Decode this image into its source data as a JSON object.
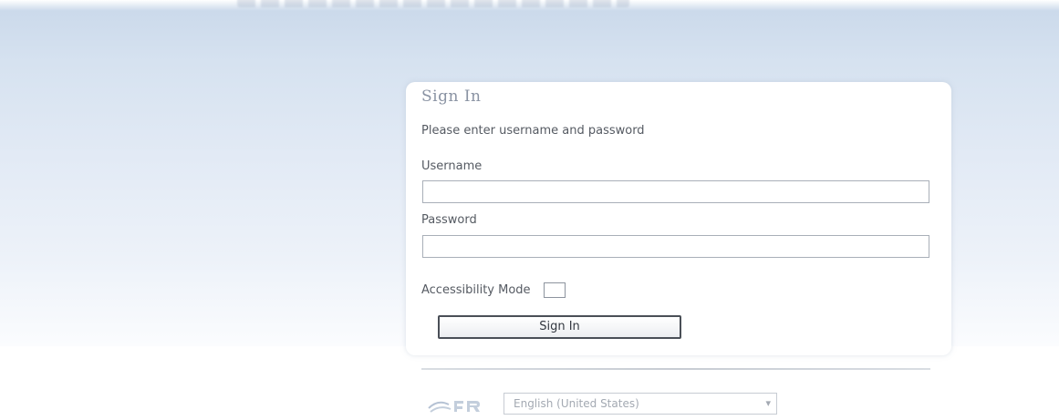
{
  "signin": {
    "title": "Sign In",
    "instruction": "Please enter username and password",
    "username_label": "Username",
    "username_value": "",
    "password_label": "Password",
    "password_value": "",
    "accessibility_label": "Accessibility Mode",
    "accessibility_checked": false,
    "submit_label": "Sign In"
  },
  "language": {
    "icon": "globe-logo-icon",
    "selected": "English (United States)"
  },
  "colors": {
    "banner_top": "#c9d8ea",
    "banner_bottom": "#edf2f9",
    "title_text": "#8a93a3",
    "body_text": "#555a62",
    "button_border": "#4a4f57"
  }
}
